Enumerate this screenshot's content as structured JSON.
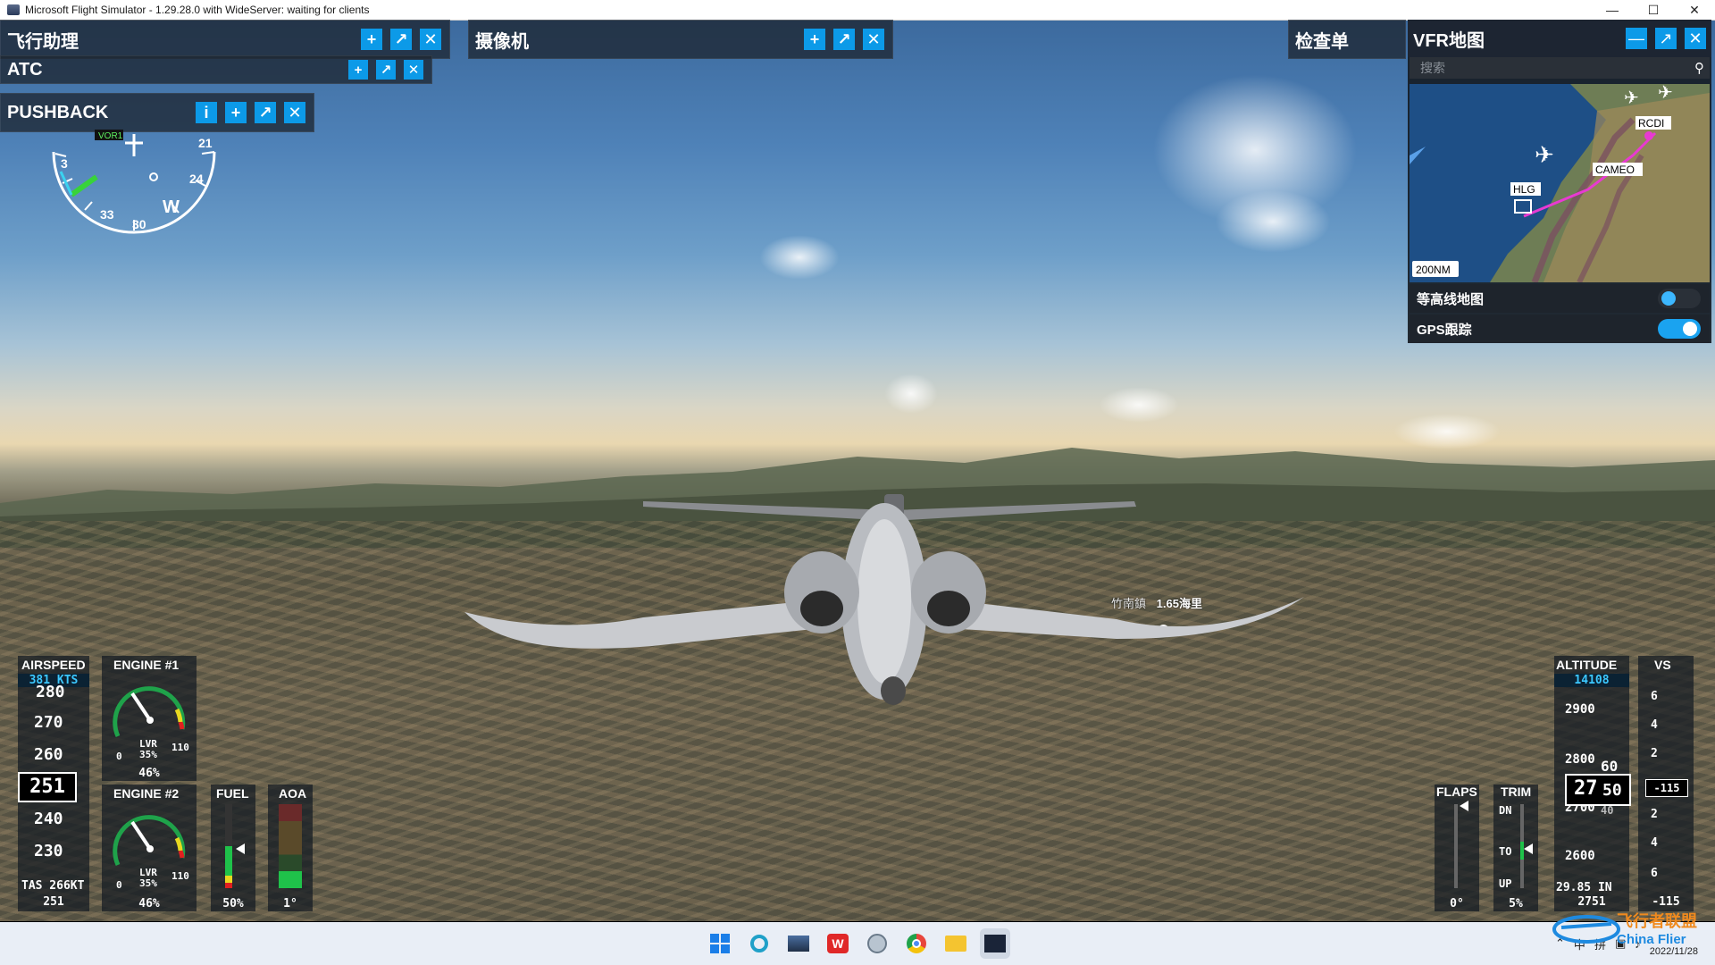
{
  "window": {
    "title": "Microsoft Flight Simulator - 1.29.28.0 with WideServer: waiting for clients"
  },
  "panels": {
    "flight_assistant": {
      "title": "飞行助理"
    },
    "atc": {
      "title": "ATC"
    },
    "pushback": {
      "title": "PUSHBACK"
    },
    "camera": {
      "title": "摄像机"
    },
    "checklist": {
      "title": "检查单"
    },
    "vfr_map": {
      "title": "VFR地图",
      "search_placeholder": "搜索",
      "scale": "200NM",
      "waypoints": [
        "RCDI",
        "CAMEO",
        "HLG"
      ],
      "contour_label": "等高线地图",
      "contour_on": false,
      "gps_label": "GPS跟踪",
      "gps_on": true
    }
  },
  "scene_label": {
    "place": "竹南鎮",
    "distance": "1.65海里"
  },
  "compass": {
    "labels": [
      "VOR1",
      "3",
      "33",
      "30",
      "W",
      "24",
      "21"
    ]
  },
  "airspeed": {
    "title": "AIRSPEED",
    "bug": "381 KTS",
    "ticks": [
      "280",
      "270",
      "260",
      "240",
      "230"
    ],
    "current": "251",
    "tas": "TAS 266KT",
    "bottom": "251"
  },
  "engine1": {
    "title": "ENGINE #1",
    "min": "0",
    "max": "110",
    "mode": "LVR",
    "pct": "35%",
    "value": "46%"
  },
  "engine2": {
    "title": "ENGINE #2",
    "min": "0",
    "max": "110",
    "mode": "LVR",
    "pct": "35%",
    "value": "46%"
  },
  "fuel": {
    "title": "FUEL",
    "value": "50%",
    "level": 0.5
  },
  "aoa": {
    "title": "AOA",
    "value": "1°"
  },
  "flaps": {
    "title": "FLAPS",
    "value": "0°"
  },
  "trim": {
    "title": "TRIM",
    "dn": "DN",
    "to": "TO",
    "up": "UP",
    "value": "5%"
  },
  "altitude": {
    "title": "ALTITUDE",
    "bug": "14108",
    "ticks": [
      "2900",
      "2800",
      "2700",
      "2600"
    ],
    "current_big": "27",
    "current_small": "50",
    "roll_up": "60",
    "roll_down": "40",
    "baro": "29.85 IN",
    "bottom": "2751"
  },
  "vs": {
    "title": "VS",
    "ticks": [
      "6",
      "4",
      "2",
      "2",
      "4",
      "6"
    ],
    "current": "-115",
    "bottom": "-115"
  },
  "taskbar": {
    "icons": [
      "start-icon",
      "cortana-icon",
      "photos-icon",
      "wps-icon",
      "network-icon",
      "chrome-icon",
      "explorer-icon",
      "simulator-icon"
    ]
  },
  "tray": {
    "ime": "中",
    "pinyin": "拼",
    "date": "2022/11/28"
  },
  "watermark": {
    "text": "飞行者联盟",
    "sub": "China Flier"
  }
}
